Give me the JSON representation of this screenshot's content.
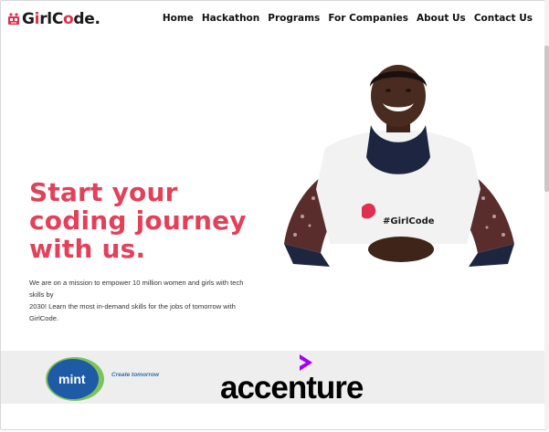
{
  "logo": {
    "text_prefix": "G",
    "text_i": "i",
    "text_rl": "rl",
    "text_code": "C",
    "text_o": "o",
    "text_de": "de",
    "text_dot": ".",
    "icon": "robot-icon"
  },
  "nav": {
    "items": [
      "Home",
      "Hackathon",
      "Programs",
      "For Companies",
      "About Us",
      "Contact Us"
    ]
  },
  "hero": {
    "title_line1": "Start your",
    "title_line2": "coding journey",
    "title_line3": "with us.",
    "desc_line1": "We are on a mission to empower 10 million women and girls with tech",
    "desc_line2": "skills by",
    "desc_line3": "2030! Learn the most in-demand skills for the jobs of tomorrow with",
    "desc_line4": "GirlCode.",
    "photo_shirt_text": "#GirlCode"
  },
  "partners": {
    "mint_label": "mint",
    "mint_tagline": "Create tomorrow",
    "accenture_label": "accenture"
  },
  "colors": {
    "accent": "#e3405a",
    "mint_blue": "#1f5aa6",
    "mint_green": "#7cc35b",
    "accenture_purple": "#a100ff"
  }
}
